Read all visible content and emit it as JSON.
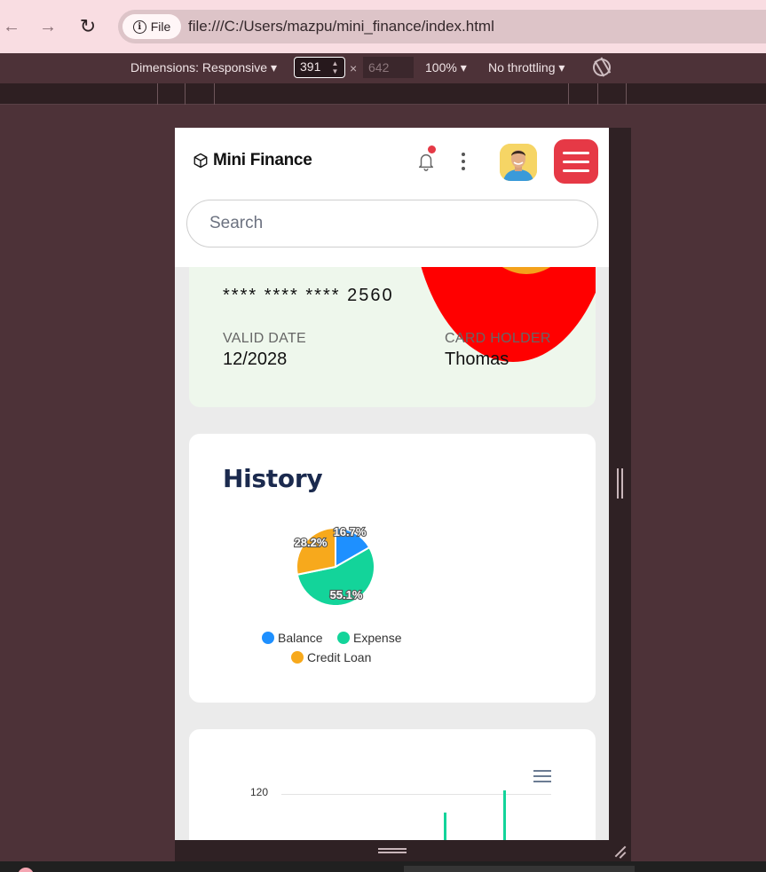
{
  "browser": {
    "file_label": "File",
    "url": "file:///C:/Users/mazpu/mini_finance/index.html"
  },
  "devtools": {
    "dimensions_label": "Dimensions: Responsive ▾",
    "width_value": "391",
    "times_symbol": "×",
    "height_value": "642",
    "zoom_label": "100% ▾",
    "throttling_label": "No throttling ▾"
  },
  "header": {
    "brand": "Mini Finance",
    "search_placeholder": "Search",
    "notification_dot_color": "#e53946",
    "menu_button_color": "#e63946"
  },
  "card": {
    "number": "****  ****  ****  2560",
    "valid_label": "VALID DATE",
    "valid_value": "12/2028",
    "holder_label": "CARD HOLDER",
    "holder_value": "Thomas"
  },
  "history": {
    "title": "History",
    "chart_data": {
      "type": "pie",
      "title": "",
      "slices": [
        {
          "name": "Balance",
          "value": 16.7,
          "label": "16.7%",
          "color": "#1e90ff"
        },
        {
          "name": "Expense",
          "value": 55.1,
          "label": "55.1%",
          "color": "#13d49a"
        },
        {
          "name": "Credit Loan",
          "value": 28.2,
          "label": "28.2%",
          "color": "#f7a91c"
        }
      ],
      "legend": "bottom"
    }
  },
  "bar_chart": {
    "chart_data": {
      "type": "bar",
      "ytick_labels": [
        "120"
      ],
      "values": [],
      "note_visible": "chart partially cut off at bottom of viewport"
    }
  }
}
